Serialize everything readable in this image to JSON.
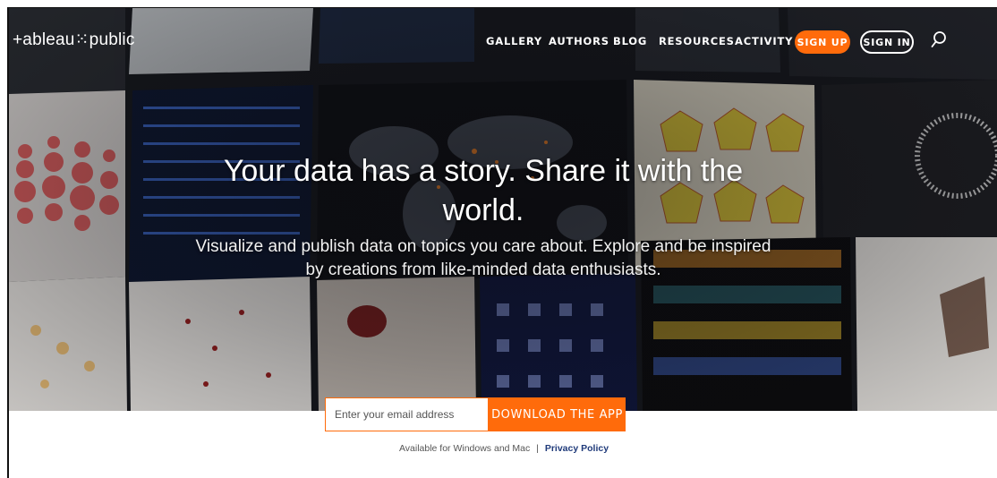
{
  "brand": {
    "logo_text": "+ableau⁙public"
  },
  "nav": {
    "links": [
      "GALLERY",
      "AUTHORS",
      "BLOG",
      "RESOURCES",
      "ACTIVITY"
    ],
    "signup_label": "SIGN UP",
    "signin_label": "SIGN IN",
    "search_icon": "search-icon"
  },
  "hero": {
    "headline": "Your data has a story. Share it with the world.",
    "subhead": "Visualize and publish data on topics you care about. Explore and be inspired by creations from like-minded data enthusiasts."
  },
  "signup_form": {
    "email_placeholder": "Enter your email address",
    "download_label": "DOWNLOAD THE APP"
  },
  "footer_note": {
    "availability": "Available for Windows and Mac",
    "separator": "|",
    "privacy_link": "Privacy Policy"
  },
  "colors": {
    "accent": "#ff6b0b",
    "link": "#1f3a7a",
    "hero_dark": "#1a1c22"
  }
}
